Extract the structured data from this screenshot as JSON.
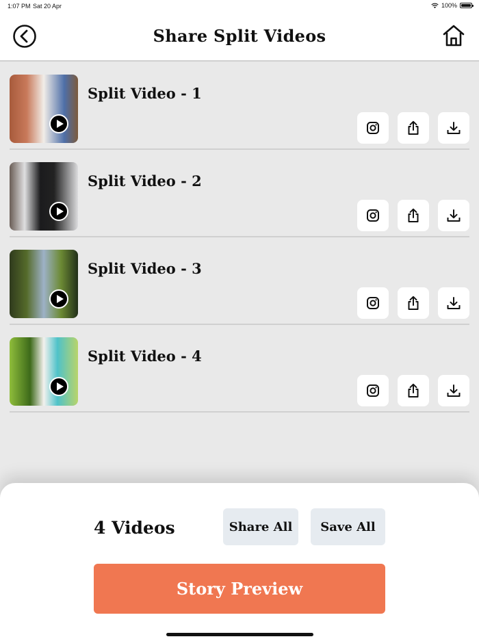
{
  "status_bar": {
    "time": "1:07 PM",
    "date": "Sat 20 Apr",
    "battery": "100%"
  },
  "header": {
    "title": "Share Split Videos",
    "back_icon": "back-arrow-circle-icon",
    "home_icon": "home-icon"
  },
  "videos": [
    {
      "name": "Split Video - 1",
      "thumb_colors": [
        "#a85b3c",
        "#f1ede8",
        "#4e6fa8"
      ]
    },
    {
      "name": "Split Video - 2",
      "thumb_colors": [
        "#6a5d56",
        "#dfdfe0",
        "#1b1b1d"
      ]
    },
    {
      "name": "Split Video - 3",
      "thumb_colors": [
        "#2f3a1d",
        "#6c8a34",
        "#9db1c7"
      ]
    },
    {
      "name": "Split Video - 4",
      "thumb_colors": [
        "#8fbd3b",
        "#3d6a1a",
        "#4fc2c9"
      ]
    }
  ],
  "row_actions": [
    "instagram-icon",
    "share-icon",
    "download-icon"
  ],
  "footer": {
    "count_label": "4 Videos",
    "share_all": "Share All",
    "save_all": "Save All",
    "story_preview": "Story Preview"
  },
  "colors": {
    "accent": "#f07751",
    "secondary_button": "#e6ebf0",
    "background": "#e9e9e9"
  }
}
